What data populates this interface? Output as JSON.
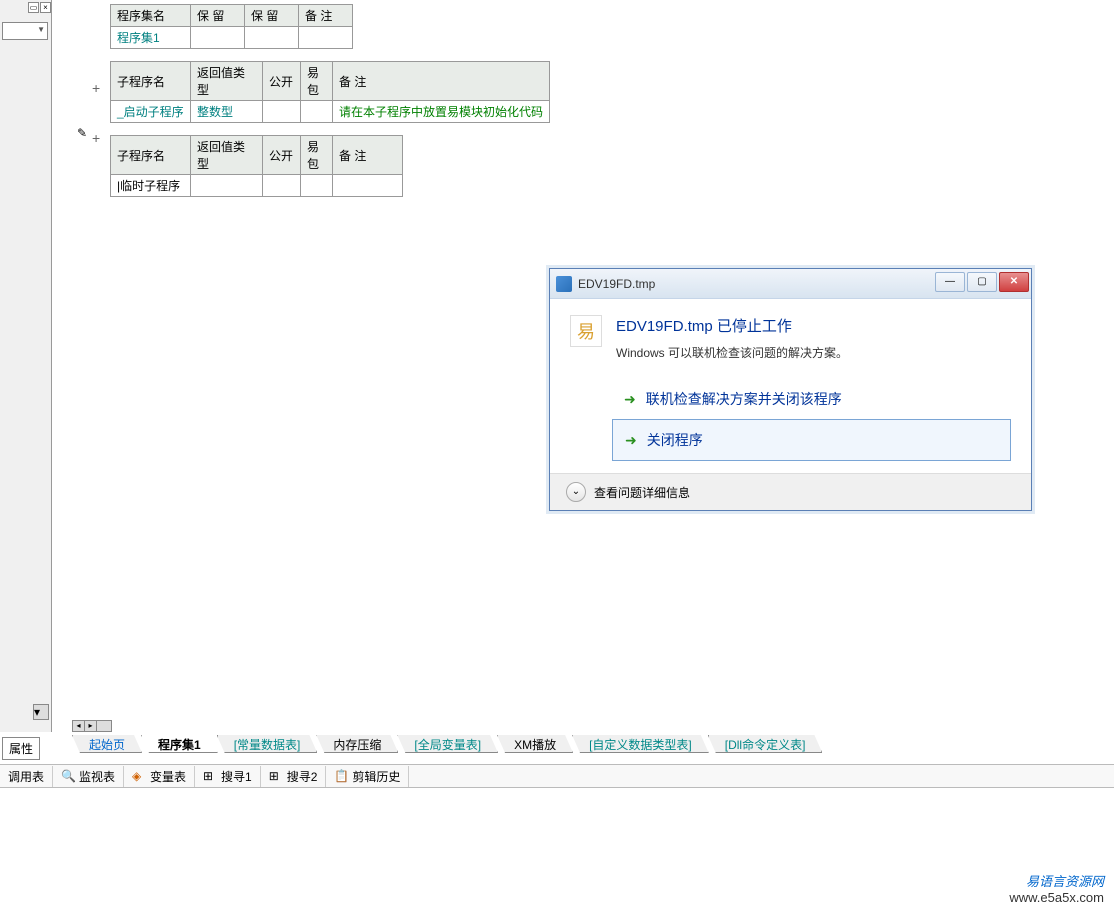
{
  "sidebar": {
    "props_label": "属性"
  },
  "tables": {
    "t1": {
      "headers": [
        "程序集名",
        "保 留",
        "保 留",
        "备 注"
      ],
      "row": [
        "程序集1",
        "",
        "",
        ""
      ]
    },
    "t2": {
      "headers": [
        "子程序名",
        "返回值类型",
        "公开",
        "易包",
        "备 注"
      ],
      "row": [
        "_启动子程序",
        "整数型",
        "",
        "",
        "请在本子程序中放置易模块初始化代码"
      ]
    },
    "t3": {
      "headers": [
        "子程序名",
        "返回值类型",
        "公开",
        "易包",
        "备 注"
      ],
      "row": [
        "|临时子程序",
        "",
        "",
        "",
        ""
      ]
    }
  },
  "tabs": [
    {
      "label": "起始页",
      "class": "blue"
    },
    {
      "label": "程序集1",
      "class": "active"
    },
    {
      "label": "[常量数据表]",
      "class": "teal"
    },
    {
      "label": "内存压缩",
      "class": ""
    },
    {
      "label": "[全局变量表]",
      "class": "teal"
    },
    {
      "label": "XM播放",
      "class": ""
    },
    {
      "label": "[自定义数据类型表]",
      "class": "teal"
    },
    {
      "label": "[Dll命令定义表]",
      "class": "teal"
    }
  ],
  "toolbar": [
    {
      "label": "调用表"
    },
    {
      "label": "监视表"
    },
    {
      "label": "变量表"
    },
    {
      "label": "搜寻1"
    },
    {
      "label": "搜寻2"
    },
    {
      "label": "剪辑历史"
    }
  ],
  "dialog": {
    "title": "EDV19FD.tmp",
    "heading": "EDV19FD.tmp 已停止工作",
    "subtext": "Windows 可以联机检查该问题的解决方案。",
    "option1": "联机检查解决方案并关闭该程序",
    "option2": "关闭程序",
    "details": "查看问题详细信息"
  },
  "watermark": {
    "line1": "易语言资源网",
    "line2": "www.e5a5x.com"
  }
}
